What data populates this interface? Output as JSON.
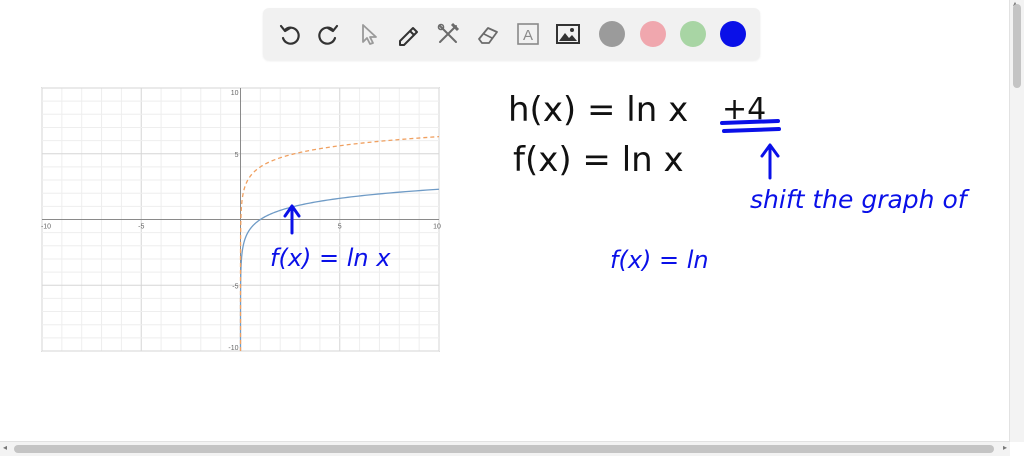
{
  "toolbar": {
    "tools": [
      {
        "name": "undo-icon"
      },
      {
        "name": "redo-icon"
      },
      {
        "name": "select-icon"
      },
      {
        "name": "pen-icon"
      },
      {
        "name": "tools-icon"
      },
      {
        "name": "eraser-icon"
      },
      {
        "name": "text-icon",
        "glyph": "A"
      },
      {
        "name": "image-icon"
      }
    ],
    "colors": [
      {
        "name": "color-gray",
        "hex": "#9b9b9b"
      },
      {
        "name": "color-pink",
        "hex": "#f0a7ae"
      },
      {
        "name": "color-green",
        "hex": "#a8d5a4"
      },
      {
        "name": "color-blue",
        "hex": "#0a10e8"
      }
    ],
    "selected_color": "#0a10e8"
  },
  "chart_data": {
    "type": "line",
    "xlim": [
      -10,
      10
    ],
    "ylim": [
      -10,
      10
    ],
    "x_ticks": [
      -10,
      -5,
      5,
      10
    ],
    "y_ticks": [
      10,
      5,
      -5,
      -10
    ],
    "grid": true,
    "series": [
      {
        "function": "ln(x)",
        "color": "#6f9bc6",
        "style": "solid"
      },
      {
        "function": "ln(x) + 4",
        "color": "#f0a060",
        "style": "dashed"
      }
    ]
  },
  "handwriting": {
    "color": "#0a10e8",
    "h_def": "h(x) = ln x",
    "plus_four": "+4",
    "f_def": "f(x) = ln x",
    "note": "shift the graph of",
    "graph_label": "f(x) = ln x",
    "partial": "f(x) = ln"
  }
}
